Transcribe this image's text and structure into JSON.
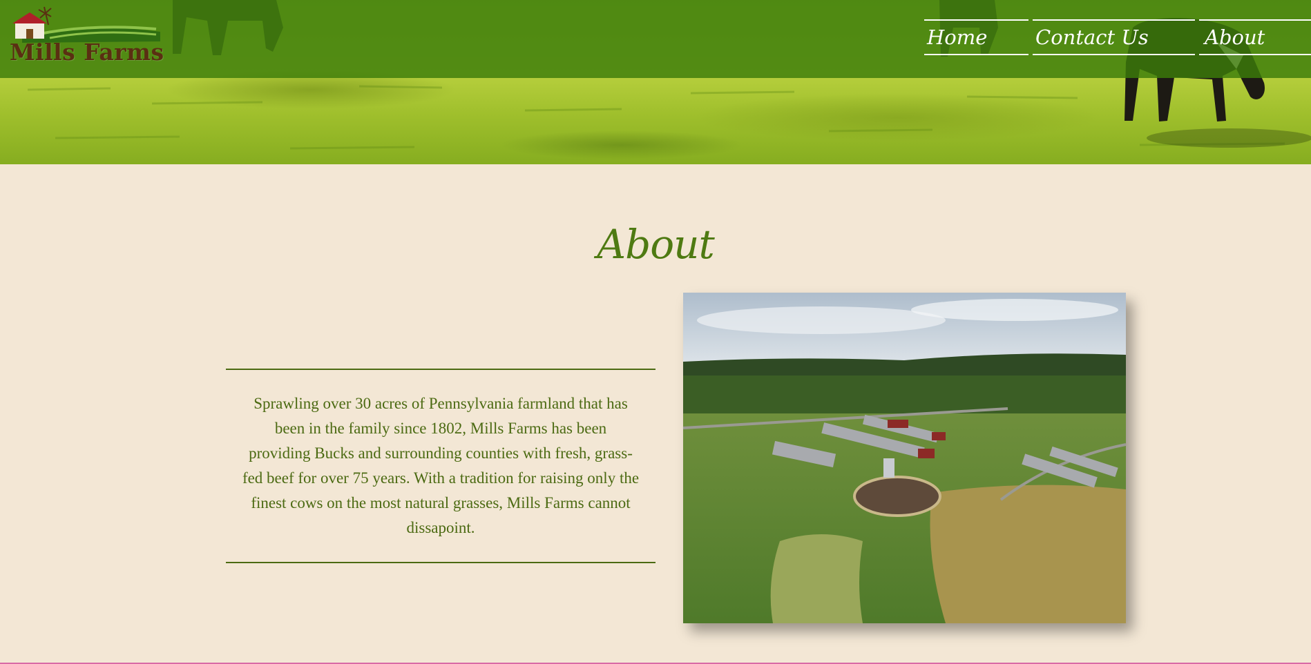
{
  "brand": {
    "name": "Mills Farms"
  },
  "nav": [
    {
      "label": "Home"
    },
    {
      "label": "Contact Us"
    },
    {
      "label": "About"
    }
  ],
  "about": {
    "title": "About",
    "body": "Sprawling over 30 acres of Pennsylvania farmland that has been in the family since 1802, Mills Farms has been providing Bucks and surrounding counties with fresh, grass-fed beef for over 75 years. With a tradition for raising only the finest cows on the most natural grasses, Mills Farms cannot dissapoint."
  },
  "colors": {
    "header_overlay": "#3c7d0a",
    "accent_green": "#4e7a12",
    "page_background": "#f3e7d5",
    "logo_text": "#5a2f12"
  }
}
